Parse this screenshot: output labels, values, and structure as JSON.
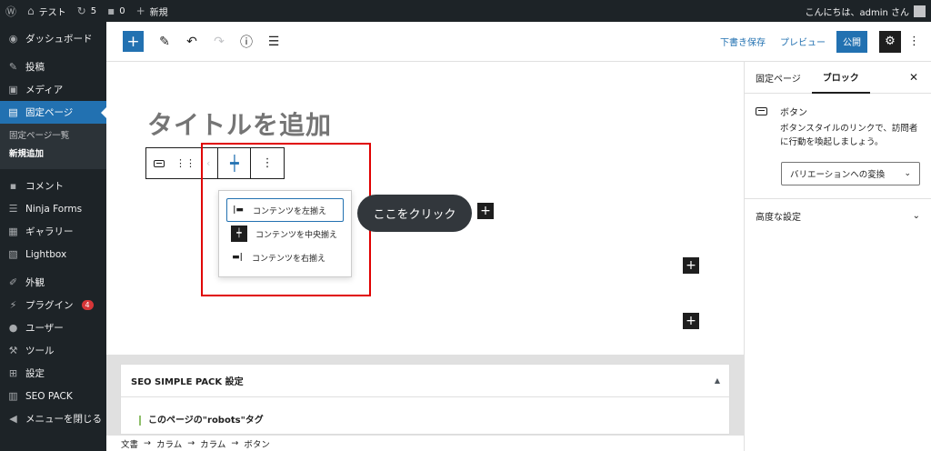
{
  "adminbar": {
    "wp_logo": "wordpress-icon",
    "site_name": "テスト",
    "updates_count": "5",
    "comments_count": "0",
    "new_label": "新規",
    "greeting": "こんにちは、admin さん"
  },
  "sidebar": {
    "dashboard": "ダッシュボード",
    "posts": "投稿",
    "media": "メディア",
    "pages": "固定ページ",
    "pages_all": "固定ページ一覧",
    "pages_new": "新規追加",
    "comments": "コメント",
    "ninja_forms": "Ninja Forms",
    "gallery": "ギャラリー",
    "lightbox": "Lightbox",
    "appearance": "外観",
    "plugins": "プラグイン",
    "plugins_badge": "4",
    "users": "ユーザー",
    "tools": "ツール",
    "settings": "設定",
    "seo_pack": "SEO PACK",
    "collapse": "メニューを閉じる"
  },
  "header": {
    "save_draft": "下書き保存",
    "preview": "プレビュー",
    "publish": "公開"
  },
  "editor": {
    "title_placeholder": "タイトルを追加",
    "button_text": "ここをクリック",
    "align_menu": {
      "left": "コンテンツを左揃え",
      "center": "コンテンツを中央揃え",
      "right": "コンテンツを右揃え"
    }
  },
  "metabox": {
    "title": "SEO SIMPLE PACK 設定",
    "robots_label": "このページの\"robots\"タグ"
  },
  "breadcrumb": [
    "文書",
    "カラム",
    "カラム",
    "ボタン"
  ],
  "settings_panel": {
    "tab_page": "固定ページ",
    "tab_block": "ブロック",
    "block_name": "ボタン",
    "block_desc": "ボタンスタイルのリンクで、訪問者に行動を喚起しましょう。",
    "variation_label": "バリエーションへの変換",
    "advanced": "高度な設定"
  },
  "colors": {
    "admin_dark": "#1d2327",
    "wp_blue": "#2271b1",
    "highlight_red": "#e00000",
    "button_dark": "#32373c"
  }
}
